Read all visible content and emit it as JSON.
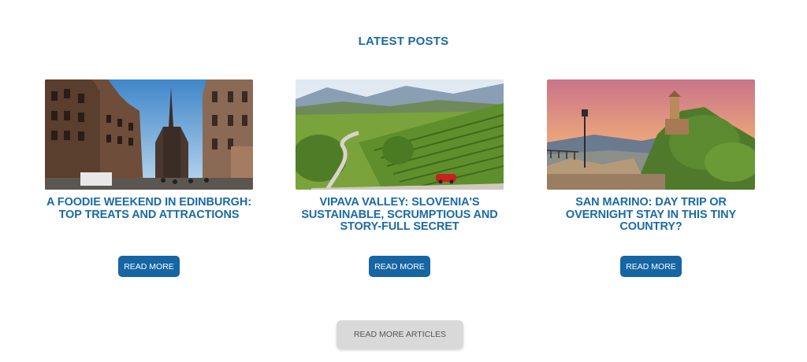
{
  "section": {
    "title": "LATEST POSTS"
  },
  "posts": [
    {
      "title": "A FOODIE WEEKEND IN EDINBURGH: TOP TREATS AND ATTRACTIONS",
      "image": "edinburgh-street-photo",
      "button_label": "READ MORE"
    },
    {
      "title": "VIPAVA VALLEY: SLOVENIA'S SUSTAINABLE, SCRUMPTIOUS AND STORY-FULL SECRET",
      "image": "vipava-vineyard-photo",
      "button_label": "READ MORE"
    },
    {
      "title": "SAN MARINO: DAY TRIP OR OVERNIGHT STAY IN THIS TINY COUNTRY?",
      "image": "san-marino-castle-photo",
      "button_label": "READ MORE"
    }
  ],
  "footer": {
    "more_articles_label": "READ MORE ARTICLES"
  },
  "colors": {
    "accent": "#1b6aa5",
    "button": "#1665a4",
    "secondary_button": "#d9d9d9"
  }
}
